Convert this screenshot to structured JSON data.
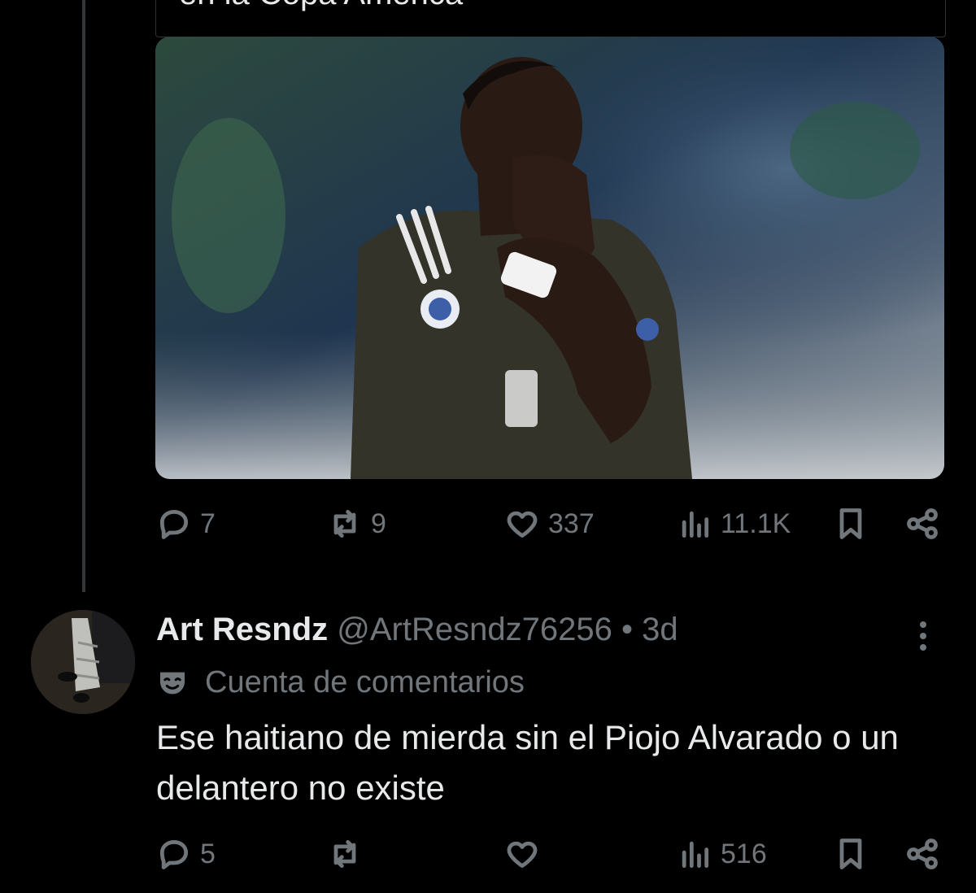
{
  "quoted_post": {
    "title_fragment": "en la Copa América",
    "image_alt": "player",
    "stats": {
      "replies": "7",
      "reposts": "9",
      "likes": "337",
      "views": "11.1K"
    }
  },
  "reply": {
    "name": "Art Resndz",
    "handle": "@ArtResndz76256",
    "separator": "•",
    "time": "3d",
    "account_label": "Cuenta de comentarios",
    "text": "Ese haitiano de mierda sin el Piojo Alvarado o un delantero no existe",
    "stats": {
      "replies": "5",
      "views": "516"
    }
  },
  "icons": {
    "reply": "reply-icon",
    "repost": "repost-icon",
    "like": "heart-icon",
    "views": "views-icon",
    "bookmark": "bookmark-icon",
    "share": "share-icon",
    "more": "more-icon",
    "account": "mask-icon"
  },
  "colors": {
    "background": "#000000",
    "text": "#e7e9ea",
    "muted": "#71767b",
    "divider": "#2f3336"
  }
}
